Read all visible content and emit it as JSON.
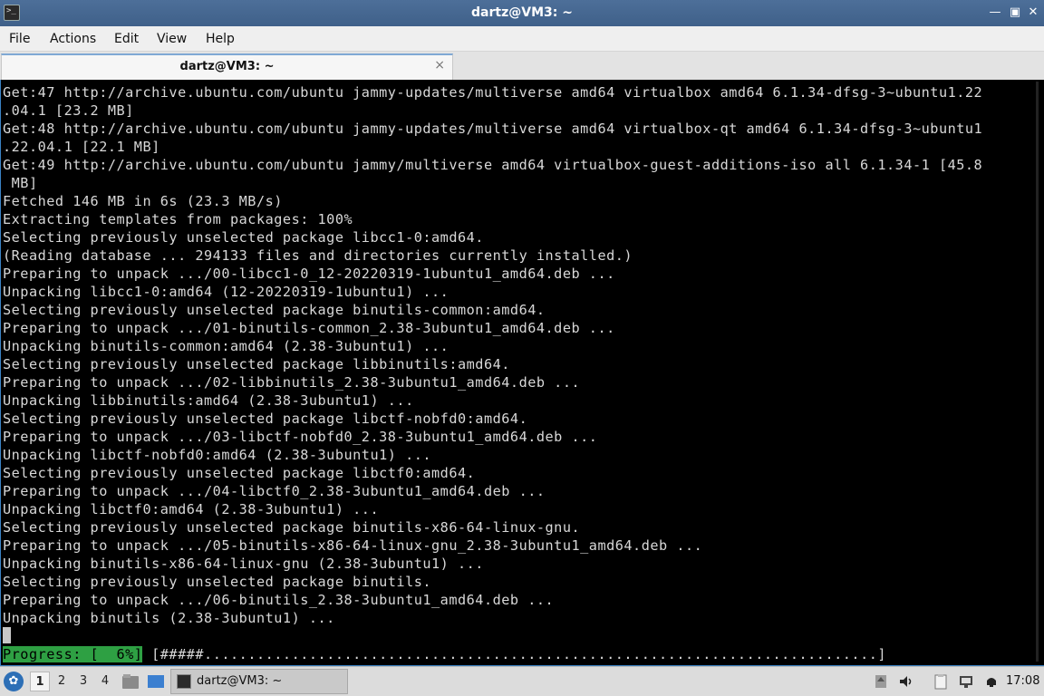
{
  "window": {
    "title": "dartz@VM3: ~"
  },
  "menu": [
    "File",
    "Actions",
    "Edit",
    "View",
    "Help"
  ],
  "tab": {
    "label": "dartz@VM3: ~",
    "close": "×"
  },
  "terminal": {
    "lines": [
      "Get:47 http://archive.ubuntu.com/ubuntu jammy-updates/multiverse amd64 virtualbox amd64 6.1.34-dfsg-3~ubuntu1.22",
      ".04.1 [23.2 MB]",
      "Get:48 http://archive.ubuntu.com/ubuntu jammy-updates/multiverse amd64 virtualbox-qt amd64 6.1.34-dfsg-3~ubuntu1",
      ".22.04.1 [22.1 MB]",
      "Get:49 http://archive.ubuntu.com/ubuntu jammy/multiverse amd64 virtualbox-guest-additions-iso all 6.1.34-1 [45.8",
      " MB]",
      "Fetched 146 MB in 6s (23.3 MB/s)",
      "Extracting templates from packages: 100%",
      "Selecting previously unselected package libcc1-0:amd64.",
      "(Reading database ... 294133 files and directories currently installed.)",
      "Preparing to unpack .../00-libcc1-0_12-20220319-1ubuntu1_amd64.deb ...",
      "Unpacking libcc1-0:amd64 (12-20220319-1ubuntu1) ...",
      "Selecting previously unselected package binutils-common:amd64.",
      "Preparing to unpack .../01-binutils-common_2.38-3ubuntu1_amd64.deb ...",
      "Unpacking binutils-common:amd64 (2.38-3ubuntu1) ...",
      "Selecting previously unselected package libbinutils:amd64.",
      "Preparing to unpack .../02-libbinutils_2.38-3ubuntu1_amd64.deb ...",
      "Unpacking libbinutils:amd64 (2.38-3ubuntu1) ...",
      "Selecting previously unselected package libctf-nobfd0:amd64.",
      "Preparing to unpack .../03-libctf-nobfd0_2.38-3ubuntu1_amd64.deb ...",
      "Unpacking libctf-nobfd0:amd64 (2.38-3ubuntu1) ...",
      "Selecting previously unselected package libctf0:amd64.",
      "Preparing to unpack .../04-libctf0_2.38-3ubuntu1_amd64.deb ...",
      "Unpacking libctf0:amd64 (2.38-3ubuntu1) ...",
      "Selecting previously unselected package binutils-x86-64-linux-gnu.",
      "Preparing to unpack .../05-binutils-x86-64-linux-gnu_2.38-3ubuntu1_amd64.deb ...",
      "Unpacking binutils-x86-64-linux-gnu (2.38-3ubuntu1) ...",
      "Selecting previously unselected package binutils.",
      "Preparing to unpack .../06-binutils_2.38-3ubuntu1_amd64.deb ...",
      "Unpacking binutils (2.38-3ubuntu1) ..."
    ],
    "progress_label": "Progress: [  6%]",
    "progress_bar": "[#####.............................................................................]",
    "progress_percent": 6
  },
  "taskbar": {
    "workspaces": [
      "1",
      "2",
      "3",
      "4"
    ],
    "task_label": "dartz@VM3: ~",
    "clock": "17:08"
  },
  "colors": {
    "titlebar": "#4d6f99",
    "progress": "#2ea043",
    "terminal_bg": "#000000"
  }
}
